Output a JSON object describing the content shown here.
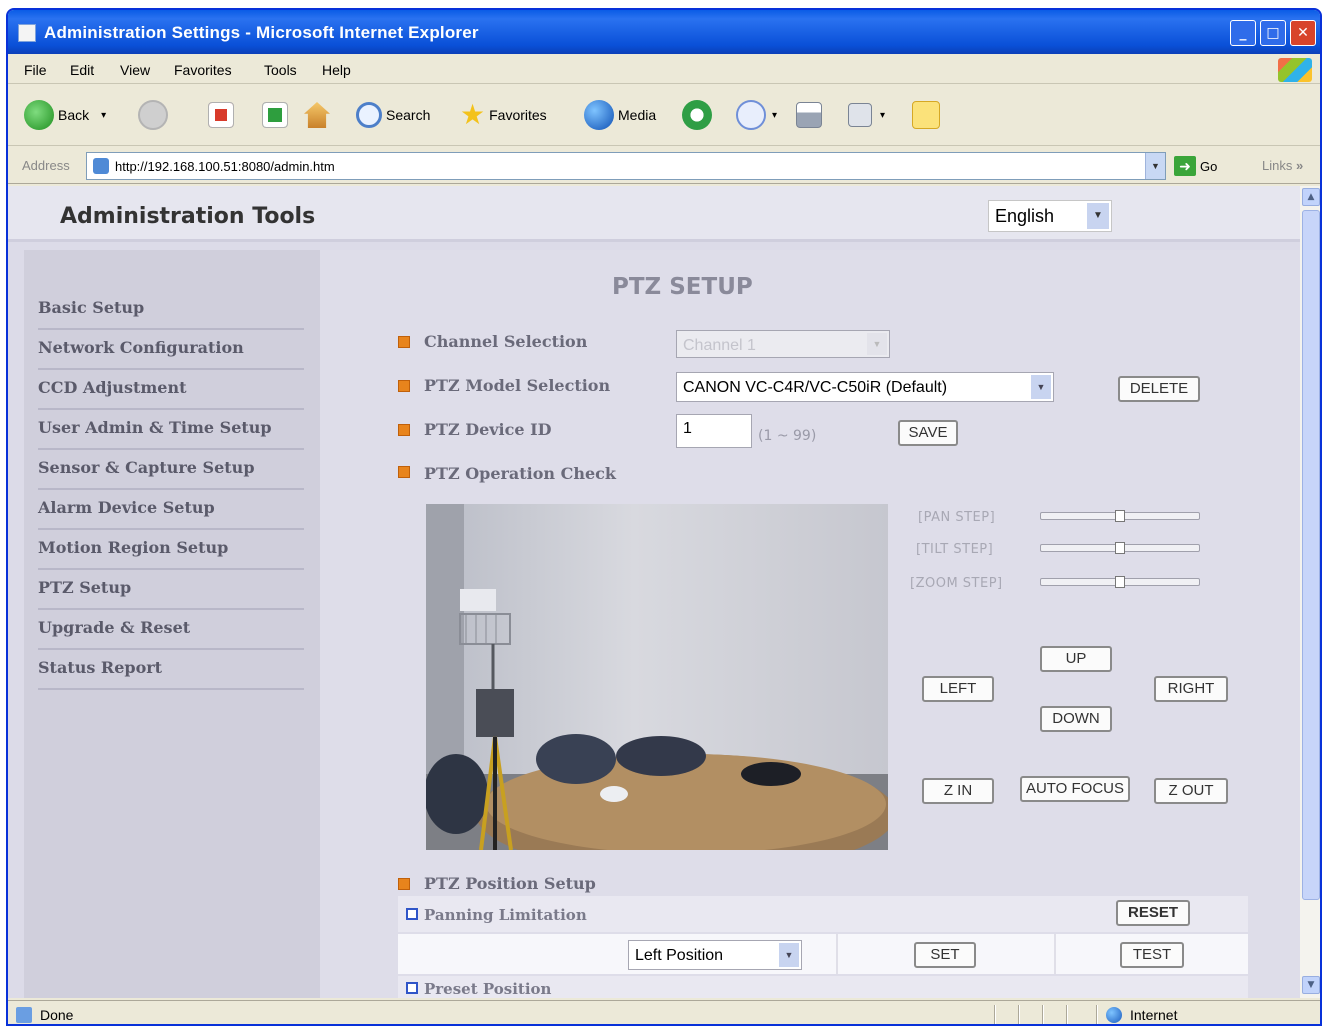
{
  "window": {
    "title": "Administration Settings - Microsoft Internet Explorer",
    "controls": {
      "minimize": "_",
      "maximize": "□",
      "close": "✕"
    }
  },
  "menu": [
    "File",
    "Edit",
    "View",
    "Favorites",
    "Tools",
    "Help"
  ],
  "toolbar": {
    "back": "Back",
    "search": "Search",
    "favorites": "Favorites",
    "media": "Media"
  },
  "address": {
    "label": "Address",
    "url": "http://192.168.100.51:8080/admin.htm",
    "go": "Go",
    "links": "Links",
    "links_chevron": "»"
  },
  "header": {
    "title": "Administration Tools",
    "language": "English"
  },
  "sidebar": {
    "items": [
      "Basic Setup",
      "Network Configuration",
      "CCD Adjustment",
      "User Admin & Time Setup",
      "Sensor & Capture Setup",
      "Alarm Device Setup",
      "Motion Region Setup",
      "PTZ Setup",
      "Upgrade & Reset",
      "Status Report"
    ]
  },
  "main": {
    "title": "PTZ SETUP",
    "channel_selection": {
      "label": "Channel Selection",
      "value": "Channel 1"
    },
    "model_selection": {
      "label": "PTZ Model Selection",
      "value": "CANON VC-C4R/VC-C50iR (Default)",
      "delete_label": "DELETE"
    },
    "device_id": {
      "label": "PTZ Device ID",
      "value": "1",
      "hint": "(1 ~ 99)",
      "save_label": "SAVE"
    },
    "operation_check": {
      "label": "PTZ Operation Check",
      "steps": [
        {
          "label": "[PAN STEP]",
          "value": 0.5
        },
        {
          "label": "[TILT STEP]",
          "value": 0.5
        },
        {
          "label": "[ZOOM STEP]",
          "value": 0.5
        }
      ],
      "buttons": {
        "up": "UP",
        "left": "LEFT",
        "right": "RIGHT",
        "down": "DOWN",
        "zoom_in": "Z IN",
        "auto_focus": "AUTO FOCUS",
        "zoom_out": "Z OUT"
      }
    },
    "position_setup": {
      "label": "PTZ Position Setup",
      "panning": {
        "label": "Panning Limitation",
        "reset_label": "RESET",
        "position_value": "Left Position",
        "set_label": "SET",
        "test_label": "TEST"
      },
      "preset": {
        "label": "Preset Position"
      }
    }
  },
  "status": {
    "text": "Done",
    "zone": "Internet"
  }
}
